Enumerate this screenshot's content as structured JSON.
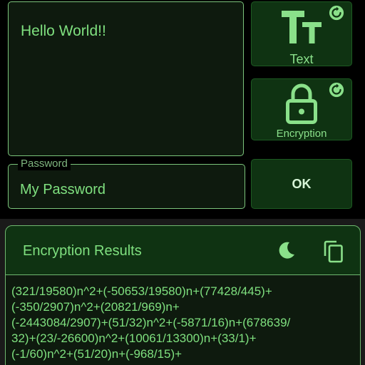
{
  "editor": {
    "text": "Hello World!!"
  },
  "buttons": {
    "text_label": "Text",
    "encryption_label": "Encryption",
    "ok_label": "OK"
  },
  "password": {
    "label": "Password",
    "value": "My Password"
  },
  "results": {
    "title": "Encryption Results",
    "output": "(321/19580)n^2+(-50653/19580)n+(77428/445)+\n(-350/2907)n^2+(20821/969)n+\n(-2443084/2907)+(51/32)n^2+(-5871/16)n+(678639/\n32)+(23/-26600)n^2+(10061/13300)n+(33/1)+\n(-1/60)n^2+(51/20)n+(-968/15)+"
  },
  "icons": {
    "text_icon": "text-size-icon",
    "reset_icon": "reset-icon",
    "lock_icon": "lock-icon",
    "moon_icon": "dark-mode-icon",
    "copy_icon": "copy-icon"
  },
  "colors": {
    "accent": "#7fe07f",
    "button_bg": "#0f3312",
    "border": "#7bc47b",
    "background": "#000000"
  }
}
